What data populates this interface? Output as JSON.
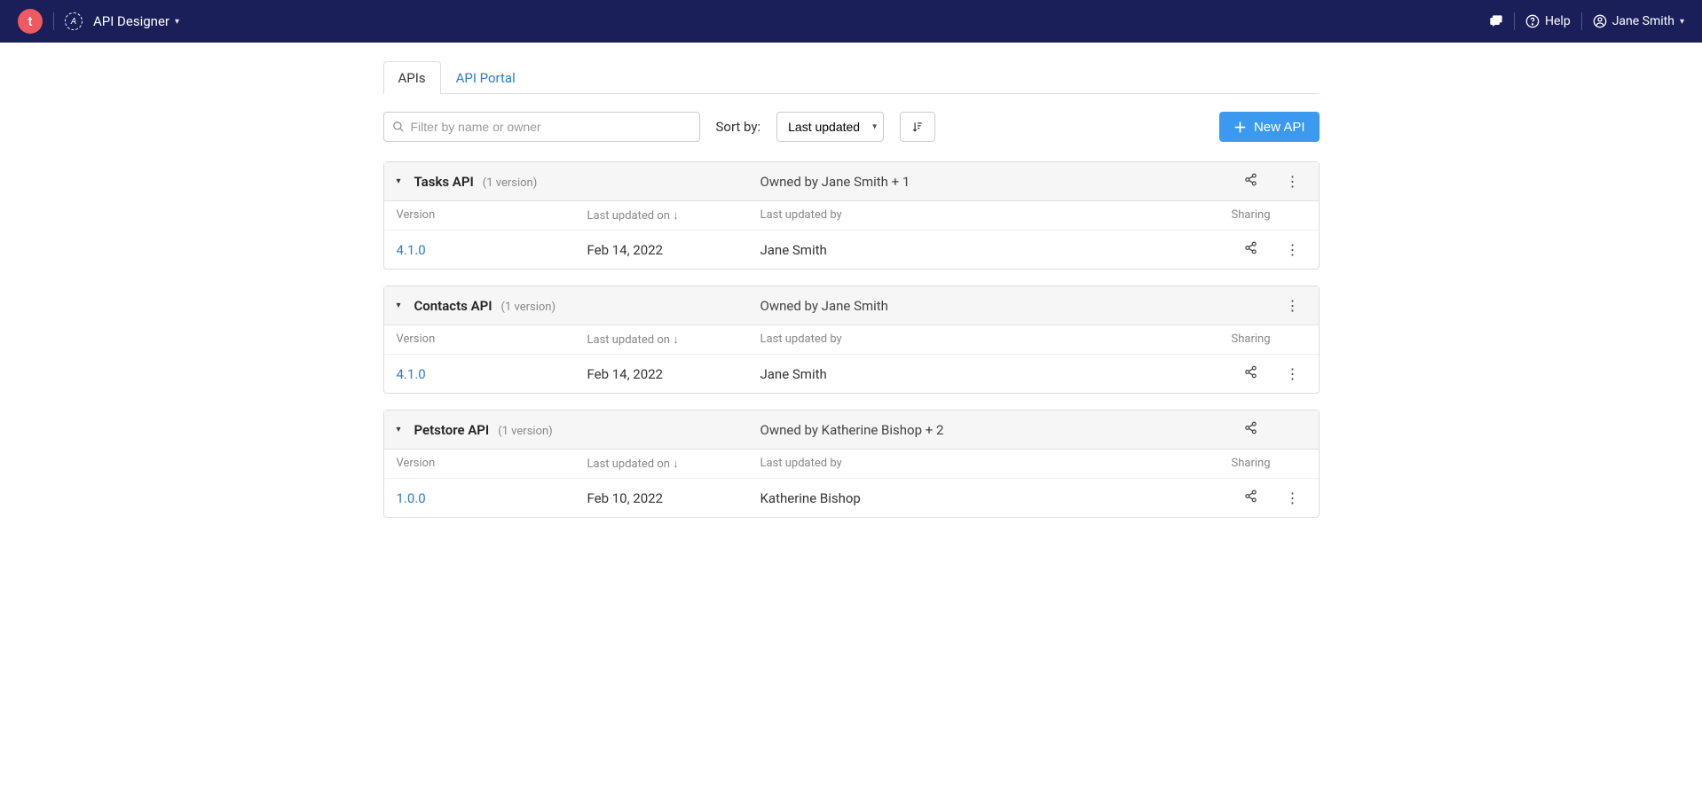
{
  "header": {
    "logo_letter": "t",
    "app_title": "API Designer",
    "help_label": "Help",
    "user_name": "Jane Smith"
  },
  "tabs": {
    "apis": "APIs",
    "portal": "API Portal"
  },
  "toolbar": {
    "filter_placeholder": "Filter by name or owner",
    "sort_label": "Sort by:",
    "sort_value": "Last updated",
    "new_api_label": "New API"
  },
  "columns": {
    "version": "Version",
    "updated_on": "Last updated on ↓",
    "updated_by": "Last updated by",
    "sharing": "Sharing"
  },
  "apis": [
    {
      "name": "Tasks API",
      "version_count": "(1 version)",
      "owner": "Owned by Jane Smith + 1",
      "show_header_share": true,
      "show_header_menu": true,
      "versions": [
        {
          "version": "4.1.0",
          "updated_on": "Feb 14, 2022",
          "updated_by": "Jane Smith"
        }
      ]
    },
    {
      "name": "Contacts API",
      "version_count": "(1 version)",
      "owner": "Owned by Jane Smith",
      "show_header_share": false,
      "show_header_menu": true,
      "versions": [
        {
          "version": "4.1.0",
          "updated_on": "Feb 14, 2022",
          "updated_by": "Jane Smith"
        }
      ]
    },
    {
      "name": "Petstore API",
      "version_count": "(1 version)",
      "owner": "Owned by Katherine Bishop + 2",
      "show_header_share": true,
      "show_header_menu": false,
      "versions": [
        {
          "version": "1.0.0",
          "updated_on": "Feb 10, 2022",
          "updated_by": "Katherine Bishop"
        }
      ]
    }
  ]
}
